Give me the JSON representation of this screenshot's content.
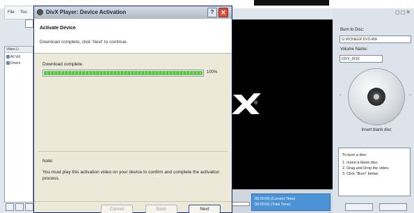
{
  "background_app": {
    "menu": {
      "file": "File",
      "tools": "Too"
    },
    "left_panel": {
      "header": "Video Li",
      "items": [
        "All Vid",
        "Downl"
      ]
    },
    "time_display": {
      "current": "00:00:00 (Current Time)",
      "total": "00:00:00 (Total Time)"
    },
    "right_panel": {
      "burn_to_disc_label": "Burn to Disc:",
      "drive_value": "G:\\PIONEER DVD-RW",
      "volume_name_label": "Volume Name:",
      "volume_name_value": "DIVX_DISC",
      "disc_caption": "Insert blank disc",
      "arrow_left": "‹",
      "arrow_right": "›",
      "burn_instructions_title": "To burn a disc:",
      "burn_steps": [
        "1. Insert a blank disc.",
        "2. Drag and Drop the video.",
        "3. Click \"Burn\" below."
      ]
    },
    "logo_reg": "®",
    "window_buttons": "◻◻✕"
  },
  "dialog": {
    "title": "DivX Player: Device Activation",
    "help_icon": "?",
    "close_icon": "✕",
    "heading": "Activate Device",
    "subheading": "Download complete, click 'Next' to continue.",
    "progress": {
      "label": "Download complete.",
      "value": 1.0,
      "percent_text": "100%"
    },
    "note_label": "Note:",
    "note_text": "You must play this activation video on your device to confirm and complete the activation process.",
    "buttons": {
      "cancel": "Cancel",
      "back": "Back",
      "next": "Next"
    }
  },
  "colors": {
    "progress_green": "#6fcf4f",
    "dialog_bg": "#ece9d8",
    "time_box_blue": "#4b93d6",
    "close_red": "#d9503a"
  }
}
